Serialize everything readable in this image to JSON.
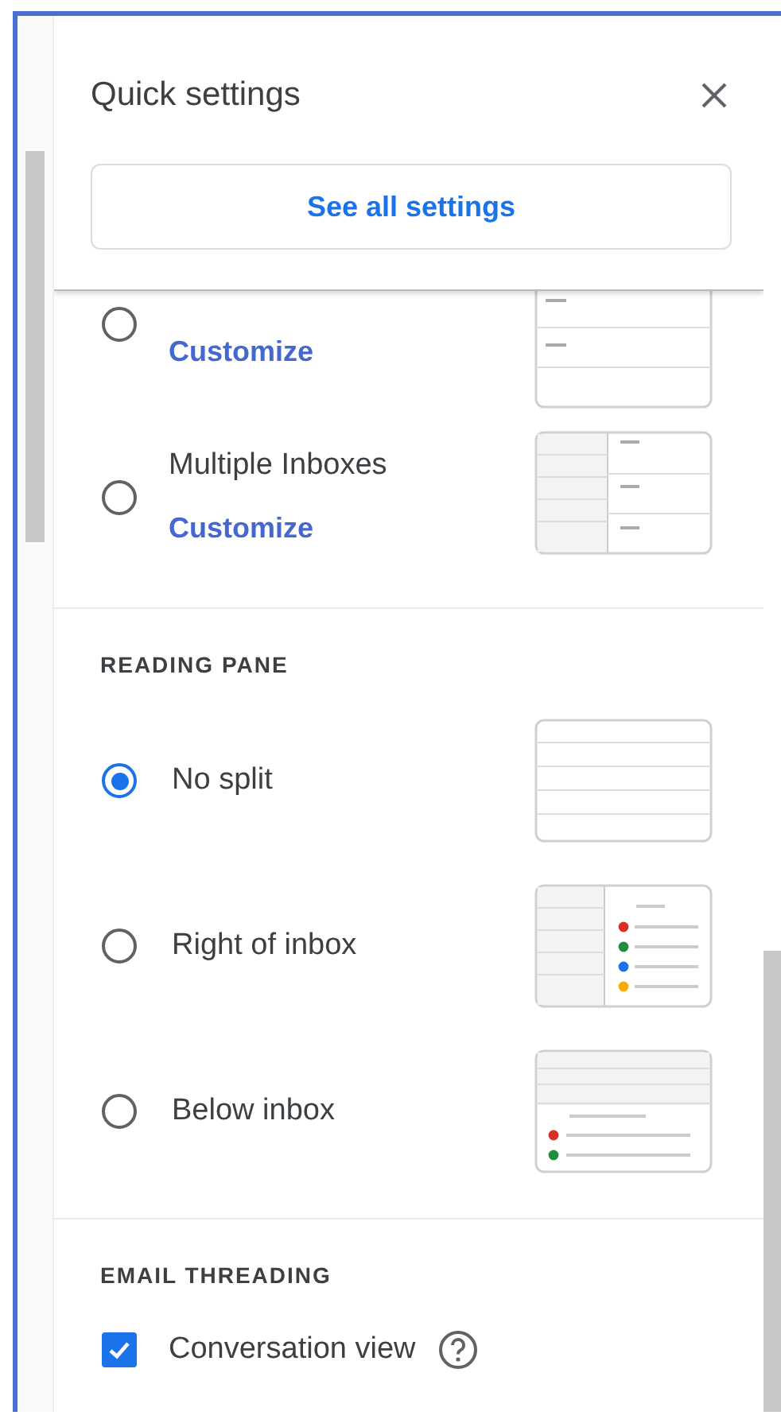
{
  "header": {
    "title": "Quick settings",
    "button": "See all settings"
  },
  "inbox_options": [
    {
      "link": "Customize",
      "selected": false,
      "kind": "priority"
    },
    {
      "label": "Multiple Inboxes",
      "link": "Customize",
      "selected": false,
      "kind": "multiple"
    }
  ],
  "reading_pane": {
    "heading": "READING PANE",
    "options": [
      {
        "label": "No split",
        "selected": true,
        "kind": "none"
      },
      {
        "label": "Right of inbox",
        "selected": false,
        "kind": "right"
      },
      {
        "label": "Below inbox",
        "selected": false,
        "kind": "below"
      }
    ]
  },
  "email_threading": {
    "heading": "EMAIL THREADING",
    "option": {
      "label": "Conversation view",
      "checked": true
    }
  }
}
